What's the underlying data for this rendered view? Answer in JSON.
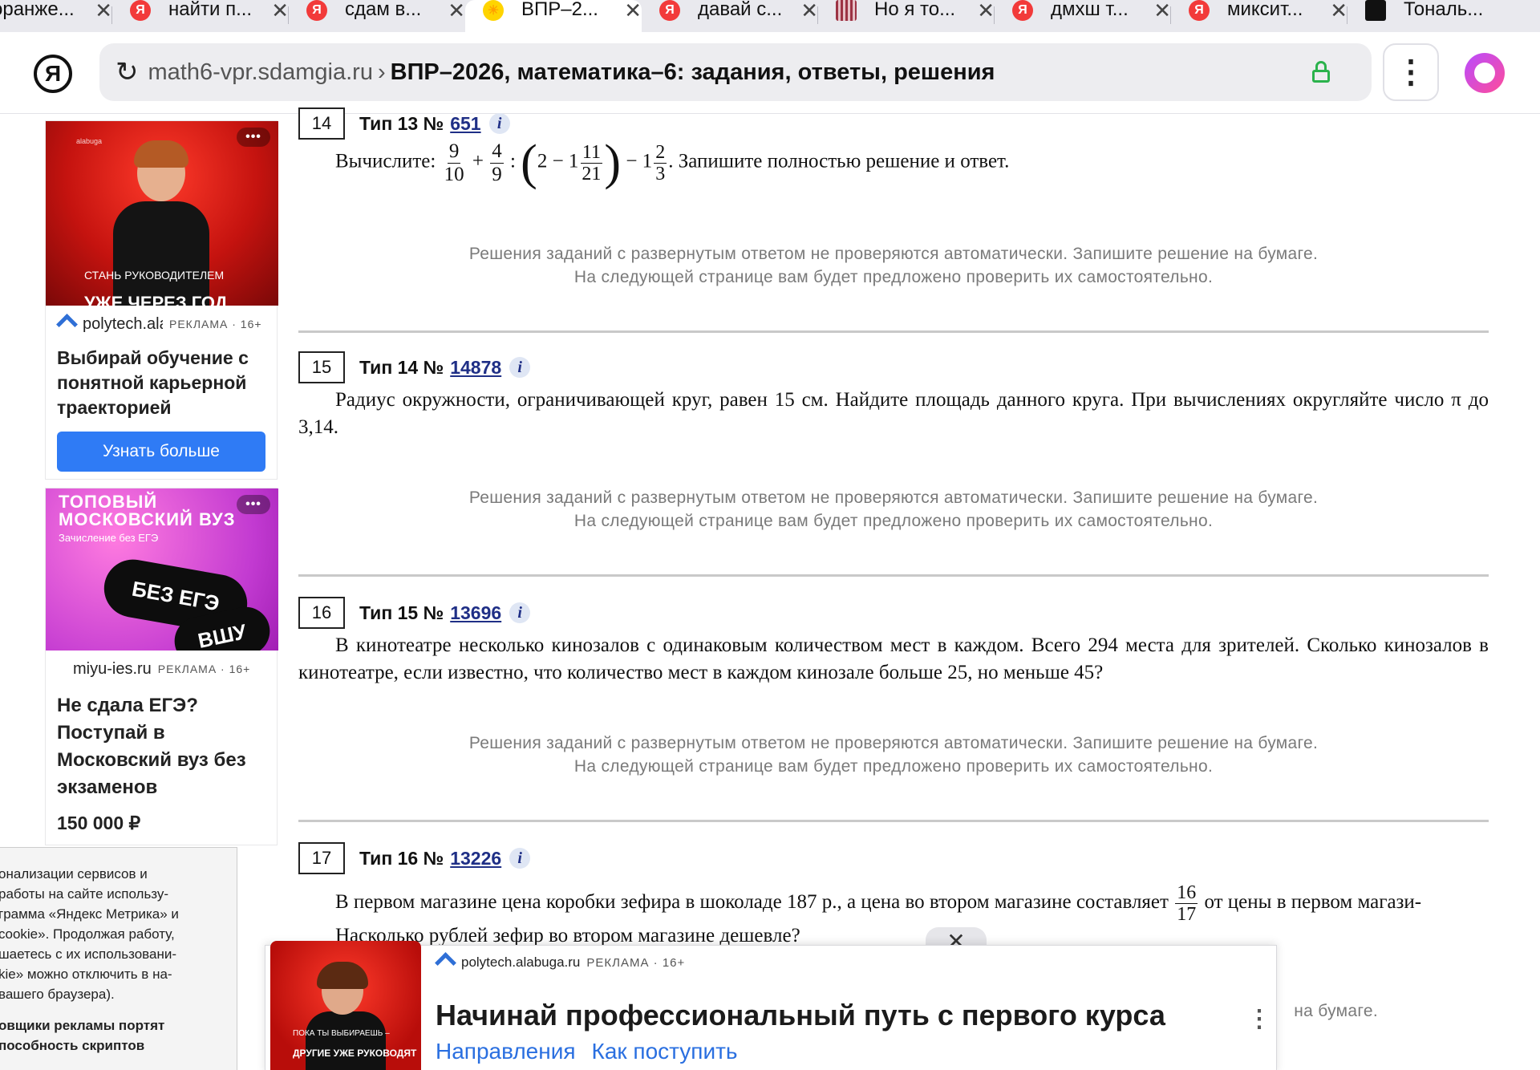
{
  "tabs": [
    {
      "title": "оранже...",
      "favicon": "ya"
    },
    {
      "title": "найти п...",
      "favicon": "ya"
    },
    {
      "title": "сдам в...",
      "favicon": "ya"
    },
    {
      "title": "ВПР–2...",
      "favicon": "sun"
    },
    {
      "title": "давай с...",
      "favicon": "ya"
    },
    {
      "title": "Но я то...",
      "favicon": "stripes"
    },
    {
      "title": "дмхш т...",
      "favicon": "ya"
    },
    {
      "title": "миксит...",
      "favicon": "ya"
    },
    {
      "title": "Тональ...",
      "favicon": "x"
    }
  ],
  "toolbar": {
    "logo": "Я",
    "url_host": "math6-vpr.sdamgia.ru",
    "url_sep": "›",
    "page_title": "ВПР–2026, математика–6: задания, ответы, решения"
  },
  "ads": {
    "ad1": {
      "caption": "СТАНЬ РУКОВОДИТЕЛЕМ",
      "caption2": "УЖЕ ЧЕРЕЗ ГОД",
      "source": "polytech.alabuga.ru",
      "tag": "РЕКЛАМА · 16+",
      "title": "Выбирай обучение с понятной карьерной траекторией",
      "button": "Узнать больше"
    },
    "ad2": {
      "headline": "ТОПОВЫЙ МОСКОВСКИЙ ВУЗ",
      "sub": "Зачисление без ЕГЭ",
      "pill1": "БЕЗ ЕГЭ",
      "pill2": "ВШУ",
      "source": "miyu-ies.ru",
      "tag": "РЕКЛАМА · 16+",
      "title": "Не сдала ЕГЭ? Поступай в Московский вуз без экзаменов",
      "price": "150 000 ₽"
    }
  },
  "cookie": {
    "text": "онализации сервисов и\n работы на сайте использу-\nграмма «Яндекс Метрика» и\ncookie». Продолжая работу,\nшаетесь с их использовани-\nkie» можно отключить в на-\n вашего браузера).",
    "bold": "овщики рекламы портят\nпособность скриптов"
  },
  "note": {
    "line1": "Решения заданий с развернутым ответом не проверяются автоматически. Запишите решение на бумаге.",
    "line2": "На следующей странице вам будет предложено проверить их самостоятельно."
  },
  "tasks": [
    {
      "number": "14",
      "type": "Тип 13 №",
      "id": "651",
      "lead": "Вычислите:",
      "tail": ". Запишите полностью решение и ответ."
    },
    {
      "number": "15",
      "type": "Тип 14 №",
      "id": "14878",
      "text": "Радиус окружности, ограничивающей круг, равен 15 см. Найдите площадь данного круга. При вычислениях округляйте число π до 3,14."
    },
    {
      "number": "16",
      "type": "Тип 15 №",
      "id": "13696",
      "text": "В кинотеатре несколько кинозалов с одинаковым количеством мест в каждом. Всего 294 места для зрителей. Сколько кинозалов в кинотеатре, если известно, что количество мест в каждом кинозале больше 25, но меньше 45?"
    },
    {
      "number": "17",
      "type": "Тип 16 №",
      "id": "13226",
      "text_a": "В первом магазине цена коробки зефира в шоколаде 187 р., а цена во втором магазине составляет",
      "frac_n": "16",
      "frac_d": "17",
      "text_b": "от цены в первом магази-",
      "text_c": "Насколько рублей зефир во втором магазине дешевле?"
    }
  ],
  "note_partial": "на бумаге.",
  "banner": {
    "source": "polytech.alabuga.ru",
    "tag": "РЕКЛАМА · 16+",
    "title": "Начинай профессиональный путь с первого курса",
    "link1": "Направления",
    "link2": "Как поступить",
    "img_t1": "ПОКА ТЫ ВЫБИРАЕШЬ –",
    "img_t2": "ДРУГИЕ УЖЕ РУКОВОДЯТ",
    "close": "✕"
  },
  "colors": {
    "link": "#1f2f86",
    "ad_button": "#2f7bf5",
    "lock": "#2bb24c",
    "note_text": "#7a7a7a"
  }
}
